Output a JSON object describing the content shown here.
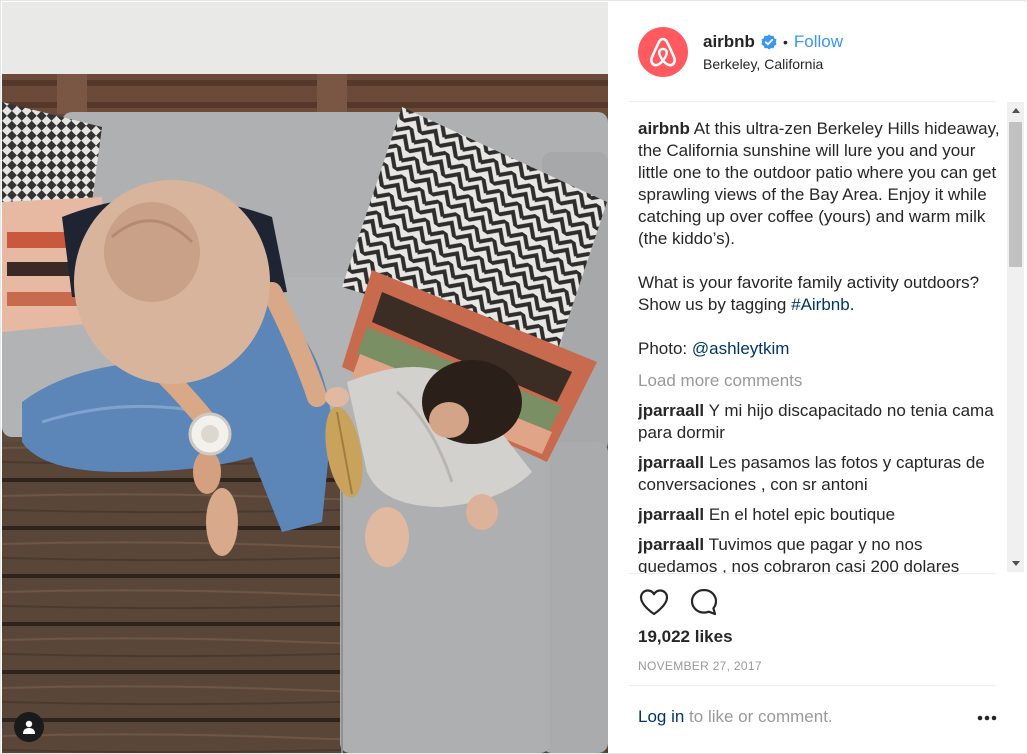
{
  "post": {
    "username": "airbnb",
    "follow_label": "Follow",
    "separator": "•",
    "location": "Berkeley, California",
    "brand_color": "#ff5a5f",
    "verified_color": "#3897f0"
  },
  "caption": {
    "username": "airbnb",
    "line1": "At this ultra-zen Berkeley Hills hideaway, the California sunshine will lure you and your little one to the outdoor patio where you can get sprawling views of the Bay Area. Enjoy it while catching up over coffee (yours) and warm milk (the kiddo’s).",
    "line2_text": "What is your favorite family activity outdoors? Show us by tagging ",
    "line2_hashtag": "#Airbnb",
    "line2_end": ".",
    "photo_label": "Photo: ",
    "photo_credit": "@ashleytkim"
  },
  "load_more_label": "Load more comments",
  "comments": [
    {
      "user": "jparraall",
      "text": "Y mi hijo discapacitado no tenia cama para dormir"
    },
    {
      "user": "jparraall",
      "text": "Les pasamos las fotos y capturas de conversaciones , con sr antoni"
    },
    {
      "user": "jparraall",
      "text": "En el hotel epic boutique"
    },
    {
      "user": "jparraall",
      "text": "Tuvimos que pagar y no nos quedamos , nos cobraron casi 200 dolares"
    }
  ],
  "likes": "19,022 likes",
  "date": "NOVEMBER 27, 2017",
  "footer": {
    "login_label": "Log in",
    "login_rest": " to like or comment."
  },
  "icons": {
    "avatar": "airbnb-logo-icon",
    "verified": "verified-badge-icon",
    "like": "heart-icon",
    "comment": "comment-bubble-icon",
    "more": "more-options-icon",
    "user_tag": "user-tag-icon"
  }
}
